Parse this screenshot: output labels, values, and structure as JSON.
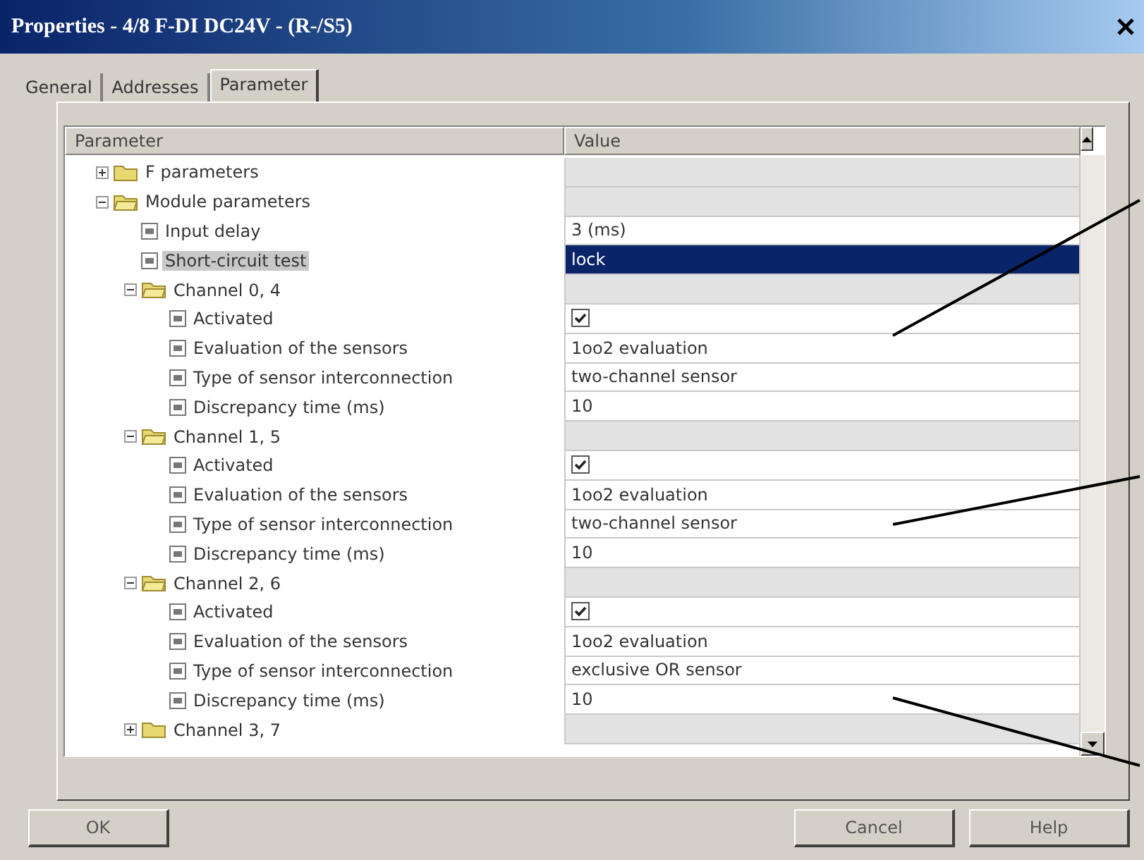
{
  "window": {
    "title": "Properties - 4/8 F-DI DC24V - (R-/S5)"
  },
  "tabs": [
    {
      "label": "General",
      "selected": false
    },
    {
      "label": "Addresses",
      "selected": false
    },
    {
      "label": "Parameter",
      "selected": true
    }
  ],
  "table": {
    "columns": [
      "Parameter",
      "Value"
    ],
    "rows": [
      {
        "kind": "folder",
        "label": "F parameters",
        "expanded": false,
        "selected": false
      },
      {
        "kind": "folder",
        "label": "Module parameters",
        "expanded": true,
        "selected": false,
        "children": [
          {
            "kind": "text",
            "label": "Input delay",
            "value": "3 (ms)",
            "selected": false
          },
          {
            "kind": "text",
            "label": "Short-circuit test",
            "value": "lock",
            "selected": true
          },
          {
            "kind": "folder",
            "label": "Channel 0, 4",
            "expanded": true,
            "selected": false,
            "children": [
              {
                "kind": "checkbox",
                "label": "Activated",
                "checked": true,
                "selected": false
              },
              {
                "kind": "text",
                "label": "Evaluation of the sensors",
                "value": "1oo2 evaluation",
                "selected": false
              },
              {
                "kind": "text",
                "label": "Type of sensor interconnection",
                "value": "two-channel sensor",
                "selected": false
              },
              {
                "kind": "text",
                "label": "Discrepancy time (ms)",
                "value": "10",
                "selected": false
              }
            ]
          },
          {
            "kind": "folder",
            "label": "Channel 1, 5",
            "expanded": true,
            "selected": false,
            "children": [
              {
                "kind": "checkbox",
                "label": "Activated",
                "checked": true,
                "selected": false
              },
              {
                "kind": "text",
                "label": "Evaluation of the sensors",
                "value": "1oo2 evaluation",
                "selected": false
              },
              {
                "kind": "text",
                "label": "Type of sensor interconnection",
                "value": "two-channel sensor",
                "selected": false
              },
              {
                "kind": "text",
                "label": "Discrepancy time (ms)",
                "value": "10",
                "selected": false
              }
            ]
          },
          {
            "kind": "folder",
            "label": "Channel 2, 6",
            "expanded": true,
            "selected": false,
            "children": [
              {
                "kind": "checkbox",
                "label": "Activated",
                "checked": true,
                "selected": false
              },
              {
                "kind": "text",
                "label": "Evaluation of the sensors",
                "value": "1oo2 evaluation",
                "selected": false
              },
              {
                "kind": "text",
                "label": "Type of sensor interconnection",
                "value": "exclusive OR sensor",
                "selected": false
              },
              {
                "kind": "text",
                "label": "Discrepancy time (ms)",
                "value": "10",
                "selected": false
              }
            ]
          },
          {
            "kind": "folder",
            "label": "Channel 3, 7",
            "expanded": false,
            "selected": false
          }
        ]
      }
    ]
  },
  "buttons": [
    {
      "label": "OK",
      "kind": "left"
    },
    {
      "label": "Cancel",
      "kind": "right"
    },
    {
      "label": "Help",
      "kind": "right"
    }
  ]
}
